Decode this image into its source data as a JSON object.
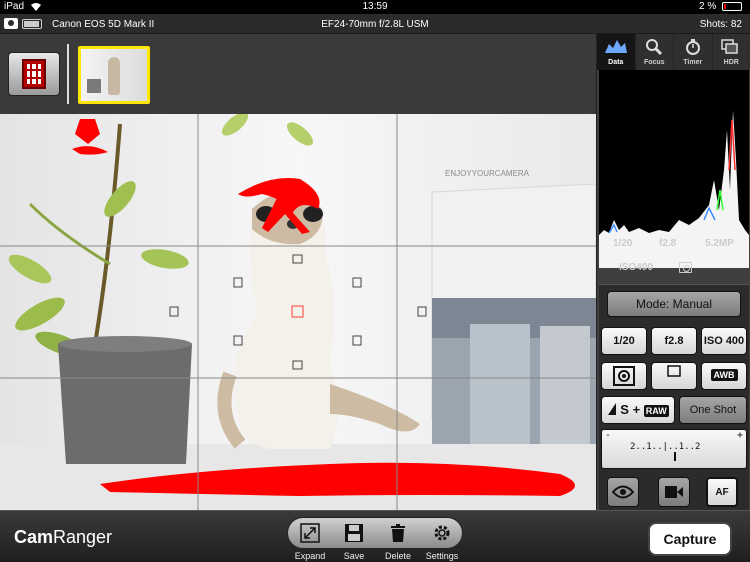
{
  "status_bar": {
    "device": "iPad",
    "time": "13:59",
    "battery": "2 %"
  },
  "camera_bar": {
    "camera_name": "Canon EOS 5D Mark II",
    "lens": "EF24-70mm f/2.8L USM",
    "shots": "Shots: 82"
  },
  "tabs": [
    {
      "label": "Data",
      "icon": "histogram-icon",
      "active": true
    },
    {
      "label": "Focus",
      "icon": "magnifier-icon"
    },
    {
      "label": "Timer",
      "icon": "stopwatch-icon"
    },
    {
      "label": "HDR",
      "icon": "hdr-icon"
    }
  ],
  "histogram_info": {
    "shutter": "1/20",
    "aperture": "f2.8",
    "resolution": "5.2MP",
    "iso": "ISO400"
  },
  "controls": {
    "mode": "Mode: Manual",
    "shutter": "1/20",
    "aperture": "f2.8",
    "iso": "ISO 400",
    "white_balance": "AWB",
    "quality_raw": "RAW",
    "af_mode": "One Shot",
    "meter_scale": "2..1..|..1..2",
    "meter_minus": "-",
    "meter_plus": "+",
    "af_button": "AF"
  },
  "toolbar": {
    "logo_cam": "Cam",
    "logo_ranger": "Ranger",
    "expand": "Expand",
    "save": "Save",
    "delete": "Delete",
    "settings": "Settings",
    "capture": "Capture"
  },
  "liveview_annotation": {
    "text_on_box": "ENJOYYOURCAMERA"
  }
}
